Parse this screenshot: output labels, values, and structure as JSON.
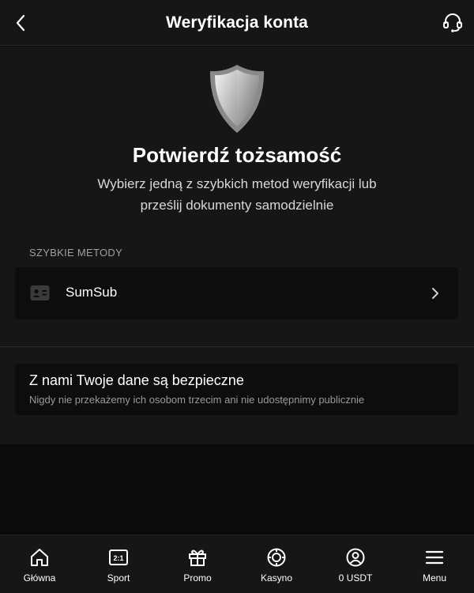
{
  "header": {
    "title": "Weryfikacja konta",
    "back_icon": "chevron-left-icon",
    "support_icon": "headset-icon"
  },
  "hero": {
    "icon": "shield-icon",
    "title": "Potwierdź tożsamość",
    "description": "Wybierz jedną z szybkich metod weryfikacji lub prześlij dokumenty samodzielnie"
  },
  "quick_methods": {
    "section_label": "SZYBKIE METODY",
    "items": [
      {
        "label": "SumSub",
        "icon": "id-card-icon"
      }
    ]
  },
  "safety": {
    "title": "Z nami Twoje dane są bezpieczne",
    "subtitle": "Nigdy nie przekażemy ich osobom trzecim ani nie udostępnimy publicznie"
  },
  "bottom_nav": {
    "items": [
      {
        "label": "Główna",
        "icon": "home-icon"
      },
      {
        "label": "Sport",
        "icon": "scoreboard-icon"
      },
      {
        "label": "Promo",
        "icon": "gift-icon"
      },
      {
        "label": "Kasyno",
        "icon": "casino-chip-icon"
      },
      {
        "label": "0 USDT",
        "icon": "user-circle-icon"
      },
      {
        "label": "Menu",
        "icon": "hamburger-icon"
      }
    ]
  },
  "colors": {
    "background": "#0b0b0b",
    "surface": "#161616",
    "card": "#0d0d0d",
    "text_primary": "#ffffff",
    "text_secondary": "#9a9a9a"
  }
}
